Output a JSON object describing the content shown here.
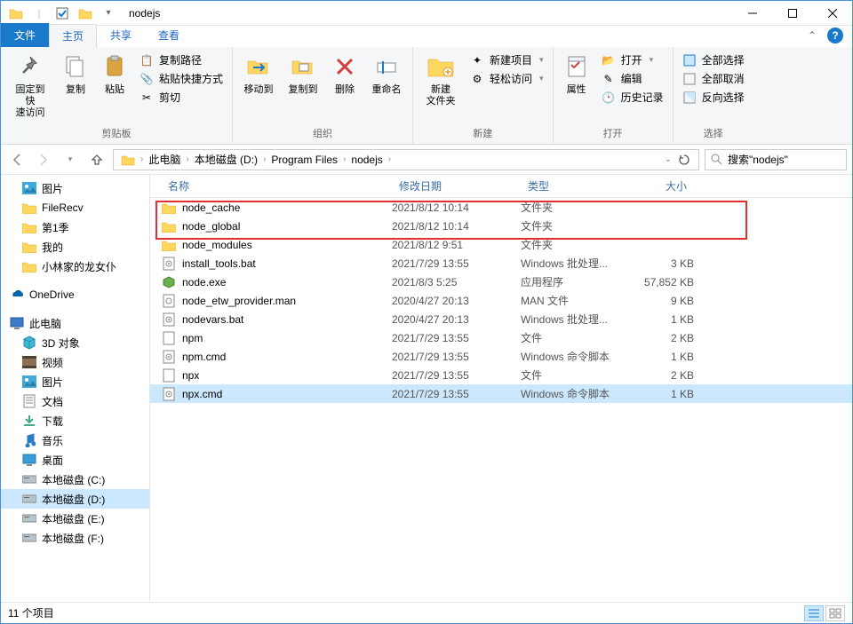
{
  "window": {
    "title": "nodejs"
  },
  "tabs": {
    "file": "文件",
    "home": "主页",
    "share": "共享",
    "view": "查看"
  },
  "ribbon": {
    "pin": "固定到快\n速访问",
    "copy": "复制",
    "paste": "粘贴",
    "copy_path": "复制路径",
    "paste_shortcut": "粘贴快捷方式",
    "cut": "剪切",
    "clipboard_group": "剪贴板",
    "move_to": "移动到",
    "copy_to": "复制到",
    "delete": "删除",
    "rename": "重命名",
    "organize_group": "组织",
    "new_folder": "新建\n文件夹",
    "new_item": "新建项目",
    "easy_access": "轻松访问",
    "new_group": "新建",
    "properties": "属性",
    "open": "打开",
    "edit": "编辑",
    "history": "历史记录",
    "open_group": "打开",
    "select_all": "全部选择",
    "select_none": "全部取消",
    "invert_selection": "反向选择",
    "select_group": "选择"
  },
  "breadcrumb": [
    "此电脑",
    "本地磁盘 (D:)",
    "Program Files",
    "nodejs"
  ],
  "search_placeholder": "搜索\"nodejs\"",
  "tree": {
    "pictures": "图片",
    "filerecv": "FileRecv",
    "season1": "第1季",
    "my": "我的",
    "xiaolin": "小林家的龙女仆",
    "onedrive": "OneDrive",
    "thispc": "此电脑",
    "objects3d": "3D 对象",
    "videos": "视频",
    "pictures2": "图片",
    "documents": "文档",
    "downloads": "下载",
    "music": "音乐",
    "desktop": "桌面",
    "diskc": "本地磁盘 (C:)",
    "diskd": "本地磁盘 (D:)",
    "diske": "本地磁盘 (E:)",
    "diskf": "本地磁盘 (F:)"
  },
  "columns": {
    "name": "名称",
    "date": "修改日期",
    "type": "类型",
    "size": "大小"
  },
  "files": [
    {
      "icon": "folder",
      "name": "node_cache",
      "date": "2021/8/12 10:14",
      "type": "文件夹",
      "size": ""
    },
    {
      "icon": "folder",
      "name": "node_global",
      "date": "2021/8/12 10:14",
      "type": "文件夹",
      "size": ""
    },
    {
      "icon": "folder",
      "name": "node_modules",
      "date": "2021/8/12 9:51",
      "type": "文件夹",
      "size": ""
    },
    {
      "icon": "bat",
      "name": "install_tools.bat",
      "date": "2021/7/29 13:55",
      "type": "Windows 批处理...",
      "size": "3 KB"
    },
    {
      "icon": "exe",
      "name": "node.exe",
      "date": "2021/8/3 5:25",
      "type": "应用程序",
      "size": "57,852 KB"
    },
    {
      "icon": "man",
      "name": "node_etw_provider.man",
      "date": "2020/4/27 20:13",
      "type": "MAN 文件",
      "size": "9 KB"
    },
    {
      "icon": "bat",
      "name": "nodevars.bat",
      "date": "2020/4/27 20:13",
      "type": "Windows 批处理...",
      "size": "1 KB"
    },
    {
      "icon": "file",
      "name": "npm",
      "date": "2021/7/29 13:55",
      "type": "文件",
      "size": "2 KB"
    },
    {
      "icon": "cmd",
      "name": "npm.cmd",
      "date": "2021/7/29 13:55",
      "type": "Windows 命令脚本",
      "size": "1 KB"
    },
    {
      "icon": "file",
      "name": "npx",
      "date": "2021/7/29 13:55",
      "type": "文件",
      "size": "2 KB"
    },
    {
      "icon": "cmd",
      "name": "npx.cmd",
      "date": "2021/7/29 13:55",
      "type": "Windows 命令脚本",
      "size": "1 KB",
      "selected": true
    }
  ],
  "status": "11 个项目",
  "highlight_rows": [
    0,
    1
  ]
}
